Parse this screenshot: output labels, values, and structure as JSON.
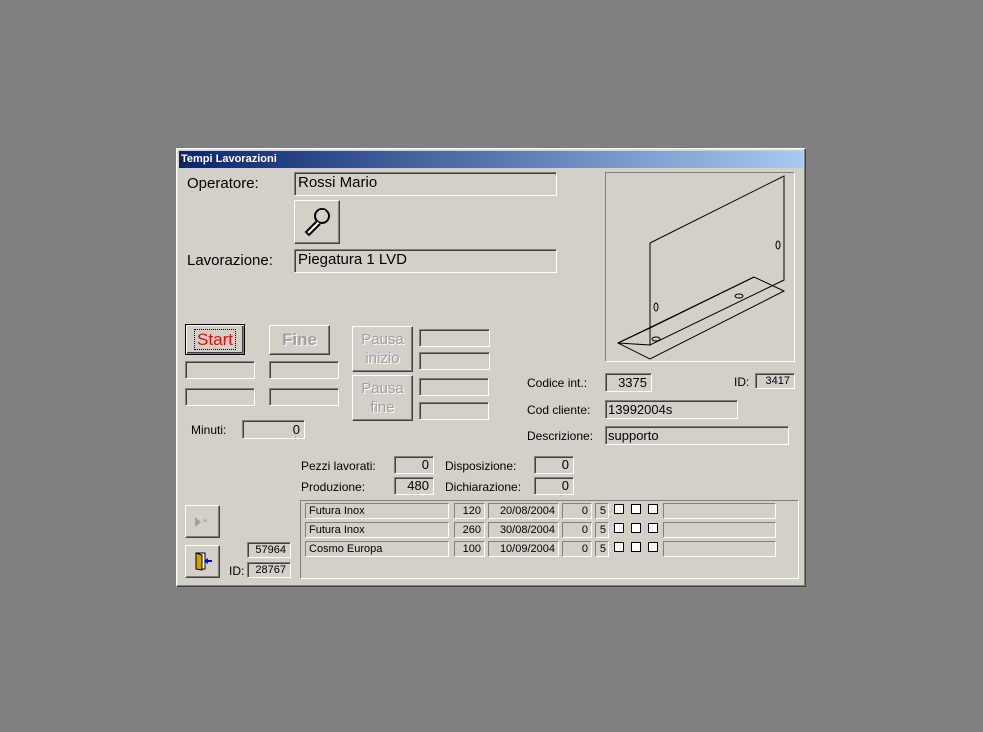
{
  "window": {
    "title": "Tempi Lavorazioni"
  },
  "operatore": {
    "label": "Operatore:",
    "value": "Rossi Mario"
  },
  "lavorazione": {
    "label": "Lavorazione:",
    "value": "Piegatura 1 LVD"
  },
  "buttons": {
    "start": "Start",
    "fine": "Fine",
    "pausa_inizio": [
      "Pausa",
      "inizio"
    ],
    "pausa_fine": [
      "Pausa",
      "fine"
    ]
  },
  "minuti": {
    "label": "Minuti:",
    "value": "0"
  },
  "codice_int": {
    "label": "Codice  int.:",
    "value": "3375"
  },
  "id_top": {
    "label": "ID:",
    "value": "3417"
  },
  "cod_cliente": {
    "label": "Cod cliente:",
    "value": "13992004s"
  },
  "descrizione": {
    "label": "Descrizione:",
    "value": "supporto"
  },
  "pezzi_lavorati": {
    "label": "Pezzi lavorati:",
    "value": "0"
  },
  "produzione": {
    "label": "Produzione:",
    "value": "480"
  },
  "disposizione": {
    "label": "Disposizione:",
    "value": "0"
  },
  "dichiarazione": {
    "label": "Dichiarazione:",
    "value": "0"
  },
  "record_number": "57964",
  "id_bottom": {
    "label": "ID:",
    "value": "28767"
  },
  "icons": {
    "tool": "wrench-icon",
    "new_record": "new-record-icon",
    "exit": "exit-door-icon"
  },
  "rows": [
    {
      "cliente": "Futura Inox",
      "qty": "120",
      "date": "20/08/2004",
      "a": "0",
      "b": "5"
    },
    {
      "cliente": "Futura Inox",
      "qty": "260",
      "date": "30/08/2004",
      "a": "0",
      "b": "5"
    },
    {
      "cliente": "Cosmo Europa",
      "qty": "100",
      "date": "10/09/2004",
      "a": "0",
      "b": "5"
    }
  ],
  "colors": {
    "start_text": "#ff0000",
    "titlebar": "#0a246a"
  }
}
